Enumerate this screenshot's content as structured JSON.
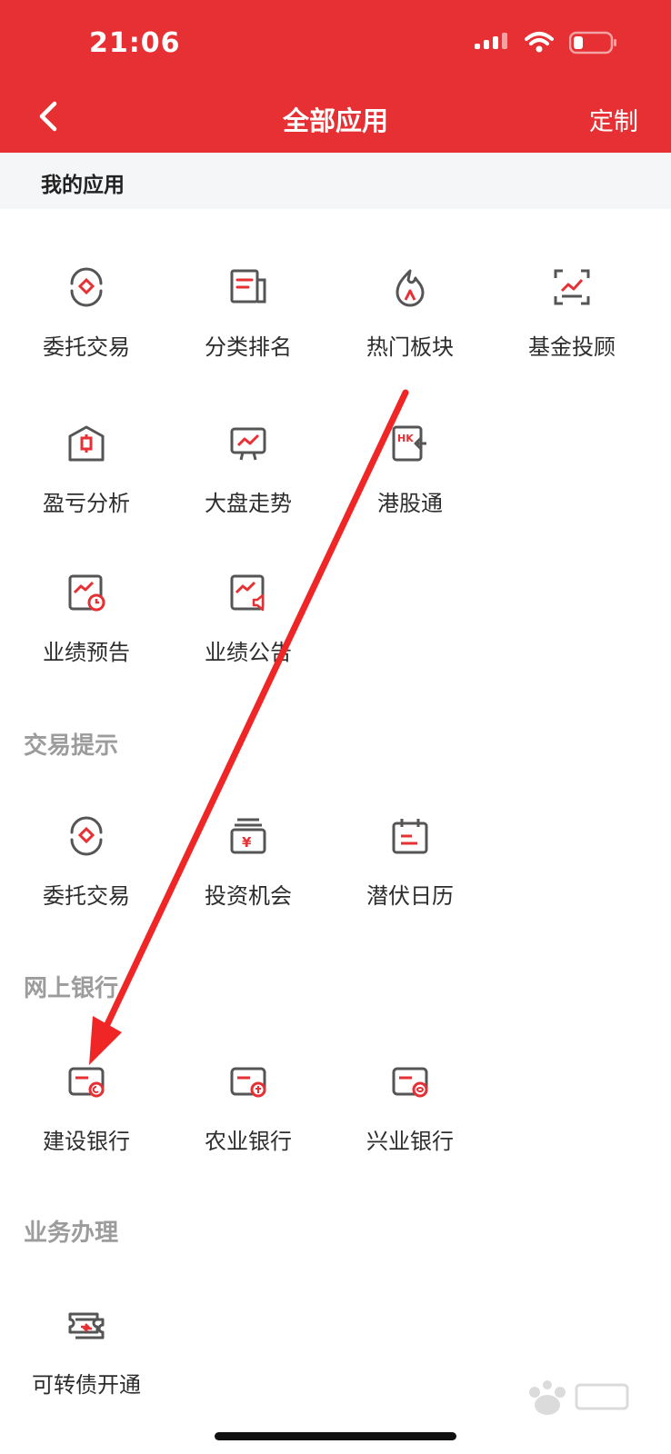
{
  "status_bar": {
    "time": "21:06"
  },
  "nav": {
    "title": "全部应用",
    "custom_label": "定制"
  },
  "my_apps": {
    "title": "我的应用",
    "items": [
      {
        "label": "委托交易",
        "icon": "entrust-icon"
      },
      {
        "label": "分类排名",
        "icon": "ranking-icon"
      },
      {
        "label": "热门板块",
        "icon": "flame-icon"
      },
      {
        "label": "基金投顾",
        "icon": "fund-advisor-icon"
      },
      {
        "label": "盈亏分析",
        "icon": "profit-analysis-icon"
      },
      {
        "label": "大盘走势",
        "icon": "market-trend-icon"
      },
      {
        "label": "港股通",
        "icon": "hk-connect-icon"
      },
      {
        "label": "业绩预告",
        "icon": "earnings-forecast-icon"
      },
      {
        "label": "业绩公告",
        "icon": "earnings-announce-icon"
      }
    ]
  },
  "trade_tips": {
    "title": "交易提示",
    "items": [
      {
        "label": "委托交易",
        "icon": "entrust-icon"
      },
      {
        "label": "投资机会",
        "icon": "opportunity-icon"
      },
      {
        "label": "潜伏日历",
        "icon": "calendar-icon"
      }
    ]
  },
  "online_bank": {
    "title": "网上银行",
    "items": [
      {
        "label": "建设银行",
        "icon": "bank-card-icon"
      },
      {
        "label": "农业银行",
        "icon": "bank-card-icon"
      },
      {
        "label": "兴业银行",
        "icon": "bank-card-icon"
      }
    ]
  },
  "business": {
    "title": "业务办理",
    "items": [
      {
        "label": "可转债开通",
        "icon": "convertible-bond-icon"
      }
    ]
  },
  "colors": {
    "brand_red": "#e63033",
    "icon_gray": "#555555",
    "icon_red": "#e63033"
  }
}
